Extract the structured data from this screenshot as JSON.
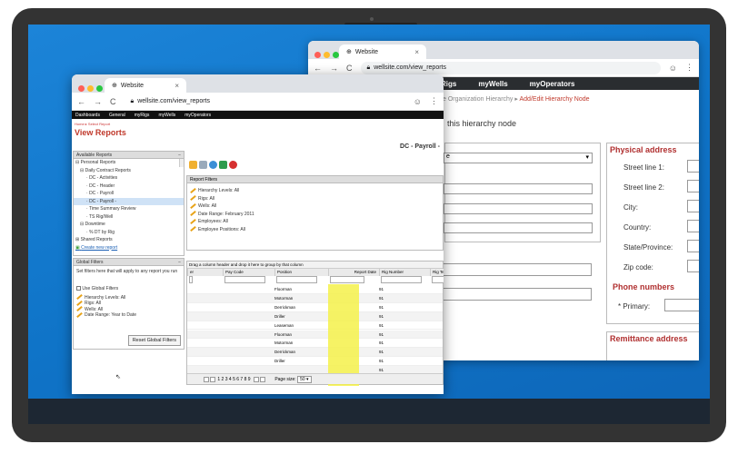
{
  "back_window": {
    "tab_title": "Website",
    "url": "wellsite.com/view_reports",
    "nav": [
      "Rigs",
      "myWells",
      "myOperators"
    ],
    "breadcrumb_prefix": "e Organization Hierarchy",
    "breadcrumb_current": "Add/Edit Hierarchy Node",
    "heading": "this hierarchy node",
    "select_value": "e",
    "physical_address_title": "Physical address",
    "labels": [
      "Street line 1:",
      "Street line 2:",
      "City:",
      "Country:",
      "State/Province:",
      "Zip code:"
    ],
    "phone_title": "Phone numbers",
    "primary_label": "* Primary:",
    "remittance_title": "Remittance address"
  },
  "front_window": {
    "tab_title": "Website",
    "url": "wellsite.com/view_reports",
    "nav": [
      "Dashboards",
      "General",
      "myRigs",
      "myWells",
      "myOperators"
    ],
    "breadcrumb": "Home ▸ Select Report",
    "title": "View Reports",
    "available_reports_header": "Available Reports",
    "tree": [
      {
        "label": "Personal Reports",
        "depth": 0
      },
      {
        "label": "Daily Contract Reports",
        "depth": 1
      },
      {
        "label": "DC - Activities",
        "depth": 2
      },
      {
        "label": "DC - Header",
        "depth": 2
      },
      {
        "label": "DC - Payroll",
        "depth": 2
      },
      {
        "label": "DC - Payroll -",
        "depth": 2
      },
      {
        "label": "Time Summary Review",
        "depth": 2
      },
      {
        "label": "TS Rig/Well",
        "depth": 2
      },
      {
        "label": "Downtime",
        "depth": 1
      },
      {
        "label": "% DT by Rig",
        "depth": 2
      },
      {
        "label": "Shared Reports",
        "depth": 0
      },
      {
        "label": "Create new report",
        "depth": 0
      }
    ],
    "global_filters_header": "Global Filters",
    "global_filters_desc": "Set filters here that will apply to any report you run",
    "use_global_filters": "Use Global Filters",
    "global_filters": [
      "Hierarchy Levels: All",
      "Rigs: All",
      "Wells: All",
      "Date Range: Year to Date"
    ],
    "reset_button": "Reset Global Filters",
    "report_title": "DC - Payroll -",
    "report_filters_header": "Report Filters",
    "report_filters": [
      "Hierarchy Levels: All",
      "Rigs: All",
      "Wells: All",
      "Date Range: February 2011",
      "Employees: All",
      "Employee Positions: All"
    ],
    "group_hint": "Drag a column header and drop it here to group by that column",
    "columns": [
      "er",
      "Pay Code",
      "Position",
      "Report Date",
      "Rig Number",
      "Rig Te"
    ],
    "rows": [
      {
        "position": "Floorman",
        "rig": "91"
      },
      {
        "position": "Motorman",
        "rig": "91"
      },
      {
        "position": "Derrickman",
        "rig": "91"
      },
      {
        "position": "Driller",
        "rig": "91"
      },
      {
        "position": "Leaseman",
        "rig": "91"
      },
      {
        "position": "Floorman",
        "rig": "91"
      },
      {
        "position": "Motorman",
        "rig": "91"
      },
      {
        "position": "Derrickman",
        "rig": "91"
      },
      {
        "position": "Driller",
        "rig": "91"
      },
      {
        "position": "",
        "rig": "91"
      }
    ],
    "pager_pages": "1 2 3 4 5 6 7 8 9",
    "page_size_label": "Page size:",
    "page_size": "50"
  }
}
